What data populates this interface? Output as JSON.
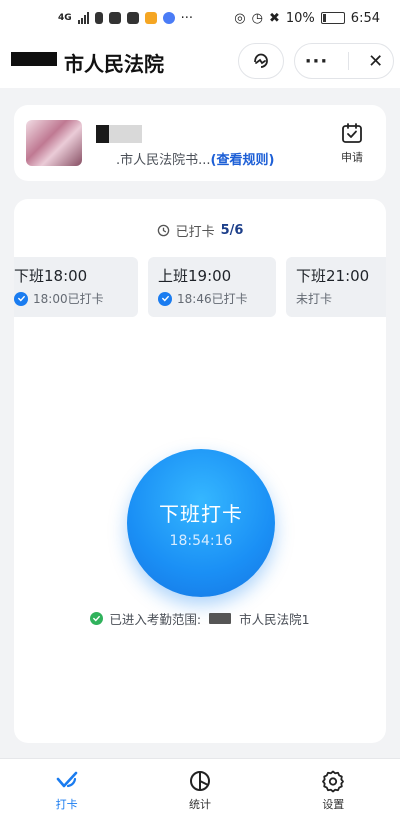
{
  "status_bar": {
    "net_label": "4G",
    "battery": "10%",
    "time": "6:54",
    "more": "···"
  },
  "header": {
    "title": "市人民法院",
    "more_icon": "ellipsis-icon",
    "close_icon": "close-icon"
  },
  "profile": {
    "org_text": ".市人民法院书...",
    "rules_link": "(查看规则)",
    "apply_label": "申请"
  },
  "punch_summary": {
    "label": "已打卡",
    "count": "5/6"
  },
  "shifts": [
    {
      "title": "下班18:00",
      "status": "18:00已打卡",
      "done": true
    },
    {
      "title": "上班19:00",
      "status": "18:46已打卡",
      "done": true
    },
    {
      "title": "下班21:00",
      "status": "未打卡",
      "done": false
    }
  ],
  "punch_button": {
    "label": "下班打卡",
    "time": "18:54:16"
  },
  "attendance_range": {
    "prefix": "已进入考勤范围:",
    "location": "市人民法院1"
  },
  "tabs": [
    {
      "label": "打卡",
      "icon": "check-icon",
      "active": true
    },
    {
      "label": "统计",
      "icon": "pie-chart-icon",
      "active": false
    },
    {
      "label": "设置",
      "icon": "gear-icon",
      "active": false
    }
  ],
  "colors": {
    "accent": "#1a7cf0",
    "success": "#30b25c"
  }
}
